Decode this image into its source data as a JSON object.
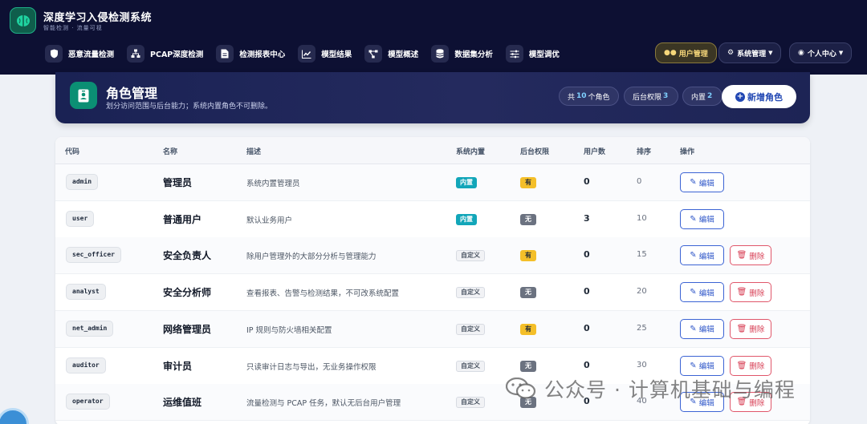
{
  "app": {
    "title": "深度学习入侵检测系统",
    "subtitle": "智能检测 · 流量可视"
  },
  "nav": [
    {
      "label": "恶意流量检测",
      "icon": "shield-icon"
    },
    {
      "label": "PCAP深度检测",
      "icon": "network-icon"
    },
    {
      "label": "检测报表中心",
      "icon": "file-report-icon"
    },
    {
      "label": "模型结果",
      "icon": "chart-line-icon"
    },
    {
      "label": "模型概述",
      "icon": "diagram-icon"
    },
    {
      "label": "数据集分析",
      "icon": "database-icon"
    },
    {
      "label": "模型调优",
      "icon": "sliders-icon"
    }
  ],
  "nav_right": {
    "user_mgmt": "用户管理",
    "system_mgmt": "系统管理",
    "personal": "个人中心"
  },
  "hero": {
    "title": "角色管理",
    "subtitle": "划分访问范围与后台能力；系统内置角色不可删除。",
    "total_prefix": "共",
    "total_count": "10",
    "total_suffix": "个角色",
    "admin_label": "后台权限",
    "admin_count": "3",
    "builtin_label": "内置",
    "builtin_count": "2",
    "add_button": "新增角色"
  },
  "table": {
    "headers": {
      "code": "代码",
      "name": "名称",
      "desc": "描述",
      "builtin": "系统内置",
      "admin": "后台权限",
      "users": "用户数",
      "sort": "排序",
      "actions": "操作"
    },
    "edit_label": "编辑",
    "delete_label": "删除",
    "rows": [
      {
        "code": "admin",
        "name": "管理员",
        "desc": "系统内置管理员",
        "builtin": "内置",
        "builtin_yes": true,
        "admin": "有",
        "admin_yes": true,
        "users": "0",
        "sort": "0",
        "deletable": false
      },
      {
        "code": "user",
        "name": "普通用户",
        "desc": "默认业务用户",
        "builtin": "内置",
        "builtin_yes": true,
        "admin": "无",
        "admin_yes": false,
        "users": "3",
        "sort": "10",
        "deletable": false
      },
      {
        "code": "sec_officer",
        "name": "安全负责人",
        "desc": "除用户管理外的大部分分析与管理能力",
        "builtin": "自定义",
        "builtin_yes": false,
        "admin": "有",
        "admin_yes": true,
        "users": "0",
        "sort": "15",
        "deletable": true
      },
      {
        "code": "analyst",
        "name": "安全分析师",
        "desc": "查看报表、告警与检测结果，不可改系统配置",
        "builtin": "自定义",
        "builtin_yes": false,
        "admin": "无",
        "admin_yes": false,
        "users": "0",
        "sort": "20",
        "deletable": true
      },
      {
        "code": "net_admin",
        "name": "网络管理员",
        "desc": "IP 规则与防火墙相关配置",
        "builtin": "自定义",
        "builtin_yes": false,
        "admin": "有",
        "admin_yes": true,
        "users": "0",
        "sort": "25",
        "deletable": true
      },
      {
        "code": "auditor",
        "name": "审计员",
        "desc": "只读审计日志与导出，无业务操作权限",
        "builtin": "自定义",
        "builtin_yes": false,
        "admin": "无",
        "admin_yes": false,
        "users": "0",
        "sort": "30",
        "deletable": true
      },
      {
        "code": "operator",
        "name": "运维值班",
        "desc": "流量检测与 PCAP 任务，默认无后台用户管理",
        "builtin": "自定义",
        "builtin_yes": false,
        "admin": "无",
        "admin_yes": false,
        "users": "0",
        "sort": "40",
        "deletable": true
      }
    ]
  },
  "watermark": "公众号 · 计算机基础与编程",
  "colors": {
    "topbar": "#0d1033",
    "hero": "#1a2254",
    "accent": "#2147b3",
    "builtin_badge": "#12a6b9",
    "admin_yes": "#f4bf29",
    "admin_no": "#6b7280",
    "danger": "#d73c52"
  }
}
